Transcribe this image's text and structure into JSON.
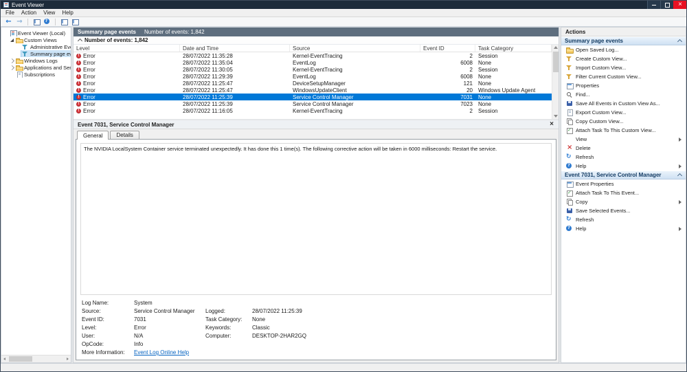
{
  "titlebar": {
    "title": "Event Viewer"
  },
  "menu": {
    "items": [
      "File",
      "Action",
      "View",
      "Help"
    ]
  },
  "tree": {
    "items": [
      {
        "label": "Event Viewer (Local)",
        "indent": 0,
        "icon": "event-viewer",
        "expander": "none",
        "selected": false
      },
      {
        "label": "Custom Views",
        "indent": 1,
        "icon": "folder",
        "expander": "expanded",
        "selected": false
      },
      {
        "label": "Administrative Events",
        "indent": 2,
        "icon": "custom-view",
        "expander": "none",
        "selected": false
      },
      {
        "label": "Summary page events",
        "indent": 2,
        "icon": "custom-view",
        "expander": "none",
        "selected": true
      },
      {
        "label": "Windows Logs",
        "indent": 1,
        "icon": "folder",
        "expander": "collapsed",
        "selected": false
      },
      {
        "label": "Applications and Services Lo",
        "indent": 1,
        "icon": "folder",
        "expander": "collapsed",
        "selected": false
      },
      {
        "label": "Subscriptions",
        "indent": 1,
        "icon": "subscriptions",
        "expander": "none",
        "selected": false
      }
    ]
  },
  "summary": {
    "header_title": "Summary page events",
    "header_count": "Number of events: 1,842",
    "group_label": "Number of events: 1,842"
  },
  "events_table": {
    "columns": [
      "Level",
      "Date and Time",
      "Source",
      "Event ID",
      "Task Category"
    ],
    "rows": [
      {
        "level": "Error",
        "date_time": "28/07/2022 11:35:28",
        "source": "Kernel-EventTracing",
        "event_id": "2",
        "task_category": "Session",
        "selected": false
      },
      {
        "level": "Error",
        "date_time": "28/07/2022 11:35:04",
        "source": "EventLog",
        "event_id": "6008",
        "task_category": "None",
        "selected": false
      },
      {
        "level": "Error",
        "date_time": "28/07/2022 11:30:05",
        "source": "Kernel-EventTracing",
        "event_id": "2",
        "task_category": "Session",
        "selected": false
      },
      {
        "level": "Error",
        "date_time": "28/07/2022 11:29:39",
        "source": "EventLog",
        "event_id": "6008",
        "task_category": "None",
        "selected": false
      },
      {
        "level": "Error",
        "date_time": "28/07/2022 11:25:47",
        "source": "DeviceSetupManager",
        "event_id": "121",
        "task_category": "None",
        "selected": false
      },
      {
        "level": "Error",
        "date_time": "28/07/2022 11:25:47",
        "source": "WindowsUpdateClient",
        "event_id": "20",
        "task_category": "Windows Update Agent",
        "selected": false
      },
      {
        "level": "Error",
        "date_time": "28/07/2022 11:25:39",
        "source": "Service Control Manager",
        "event_id": "7031",
        "task_category": "None",
        "selected": true
      },
      {
        "level": "Error",
        "date_time": "28/07/2022 11:25:39",
        "source": "Service Control Manager",
        "event_id": "7023",
        "task_category": "None",
        "selected": false
      },
      {
        "level": "Error",
        "date_time": "28/07/2022 11:16:05",
        "source": "Kernel-EventTracing",
        "event_id": "2",
        "task_category": "Session",
        "selected": false
      }
    ]
  },
  "detail": {
    "title": "Event 7031, Service Control Manager",
    "tabs": [
      {
        "label": "General",
        "active": true
      },
      {
        "label": "Details",
        "active": false
      }
    ],
    "message": "The NVIDIA LocalSystem Container service terminated unexpectedly.  It has done this 1 time(s).  The following corrective action will be taken in 6000 milliseconds: Restart the service.",
    "fields": [
      {
        "label1": "Log Name:",
        "value1": "System",
        "label2": "",
        "value2": "",
        "link": false
      },
      {
        "label1": "Source:",
        "value1": "Service Control Manager",
        "label2": "Logged:",
        "value2": "28/07/2022 11:25:39",
        "link": false
      },
      {
        "label1": "Event ID:",
        "value1": "7031",
        "label2": "Task Category:",
        "value2": "None",
        "link": false
      },
      {
        "label1": "Level:",
        "value1": "Error",
        "label2": "Keywords:",
        "value2": "Classic",
        "link": false
      },
      {
        "label1": "User:",
        "value1": "N/A",
        "label2": "Computer:",
        "value2": "DESKTOP-2HAR2GQ",
        "link": false
      },
      {
        "label1": "OpCode:",
        "value1": "Info",
        "label2": "",
        "value2": "",
        "link": false
      },
      {
        "label1": "More Information:",
        "value1": "Event Log Online Help",
        "label2": "",
        "value2": "",
        "link": true
      }
    ]
  },
  "actions": {
    "title": "Actions",
    "sections": [
      {
        "header": "Summary page events",
        "items": [
          {
            "label": "Open Saved Log...",
            "icon": "open-folder",
            "submenu": false
          },
          {
            "label": "Create Custom View...",
            "icon": "filter",
            "submenu": false
          },
          {
            "label": "Import Custom View...",
            "icon": "filter",
            "submenu": false
          },
          {
            "label": "Filter Current Custom View...",
            "icon": "filter",
            "submenu": false
          },
          {
            "label": "Properties",
            "icon": "properties",
            "submenu": false
          },
          {
            "label": "Find...",
            "icon": "find",
            "submenu": false
          },
          {
            "label": "Save All Events in Custom View As...",
            "icon": "save",
            "submenu": false
          },
          {
            "label": "Export Custom View...",
            "icon": "page",
            "submenu": false
          },
          {
            "label": "Copy Custom View...",
            "icon": "copy",
            "submenu": false
          },
          {
            "label": "Attach Task To This Custom View...",
            "icon": "task",
            "submenu": false
          },
          {
            "label": "View",
            "icon": "none",
            "submenu": true
          },
          {
            "label": "Delete",
            "icon": "delete",
            "submenu": false
          },
          {
            "label": "Refresh",
            "icon": "refresh",
            "submenu": false
          },
          {
            "label": "Help",
            "icon": "help",
            "submenu": true
          }
        ]
      },
      {
        "header": "Event 7031, Service Control Manager",
        "items": [
          {
            "label": "Event Properties",
            "icon": "properties",
            "submenu": false
          },
          {
            "label": "Attach Task To This Event...",
            "icon": "task",
            "submenu": false
          },
          {
            "label": "Copy",
            "icon": "copy",
            "submenu": true
          },
          {
            "label": "Save Selected Events...",
            "icon": "save",
            "submenu": false
          },
          {
            "label": "Refresh",
            "icon": "refresh",
            "submenu": false
          },
          {
            "label": "Help",
            "icon": "help",
            "submenu": true
          }
        ]
      }
    ]
  },
  "colors": {
    "titlebar": "#1d2b3a",
    "close_button": "#e81123",
    "selection": "#0078d7",
    "banner": "#5e6e7e",
    "error_icon": "#d9383e",
    "link": "#0563c1"
  }
}
